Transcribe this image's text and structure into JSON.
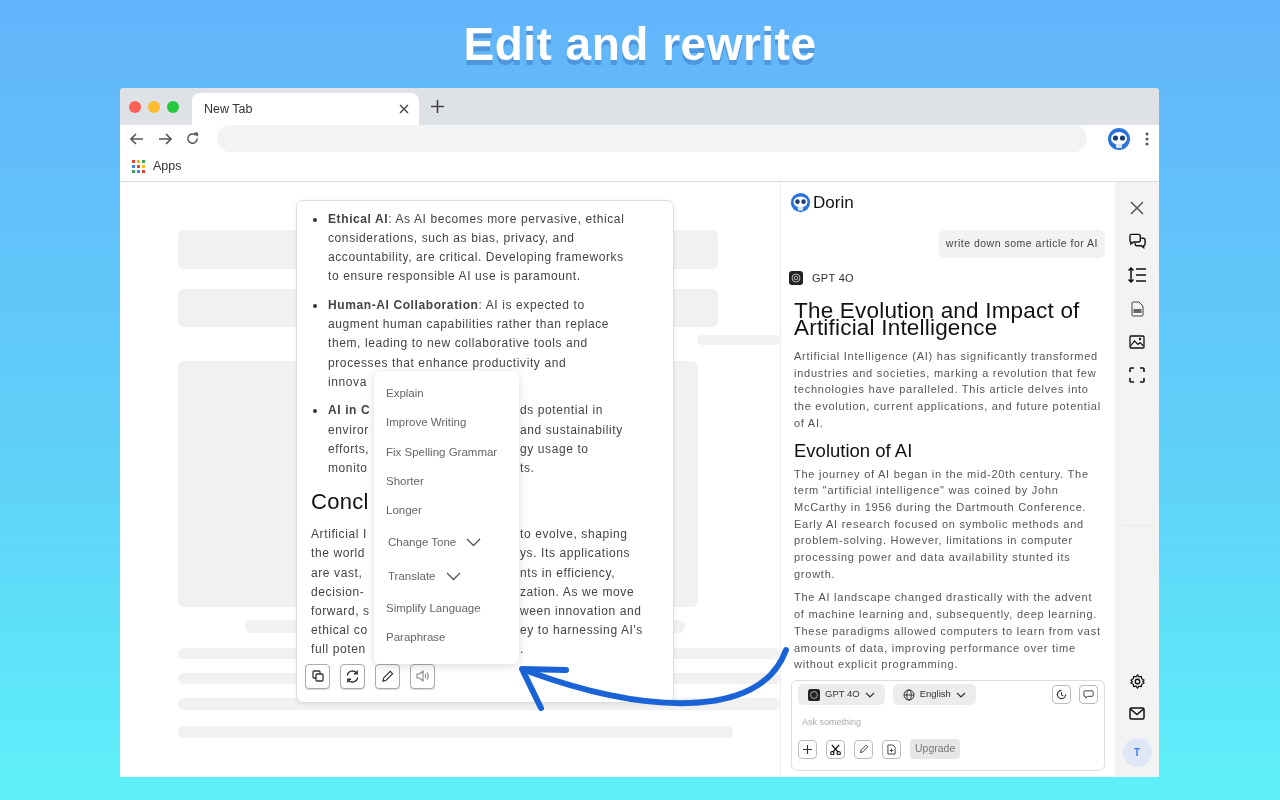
{
  "title": "Edit and rewrite",
  "browser": {
    "tab": {
      "label": "New Tab"
    },
    "bookmarks": [
      {
        "label": "Apps"
      }
    ]
  },
  "answer_card": {
    "blocks": [
      {
        "kind": "bullet",
        "lines": [
          {
            "text": "**Ethical AI**: As AI becomes more pervasive, ethical"
          },
          {
            "text": "considerations, such as bias, privacy, and"
          },
          {
            "text": "accountability, are critical. Developing frameworks"
          },
          {
            "text": "to ensure responsible AI use is paramount."
          }
        ]
      },
      {
        "kind": "bullet",
        "lines": [
          {
            "text": "**Human-AI Collaboration**: AI is expected to"
          },
          {
            "text": "augment human capabilities rather than replace"
          },
          {
            "text": "them, leading to new collaborative tools and"
          },
          {
            "text": "processes that enhance productivity and"
          },
          {
            "text": "innova"
          }
        ]
      },
      {
        "kind": "bullet",
        "lines": [
          {
            "left": "**AI in C**",
            "right": "ds potential in"
          },
          {
            "left": "enviror",
            "right": "and sustainability"
          },
          {
            "left": "efforts,",
            "right": "gy usage to"
          },
          {
            "left": "monito",
            "right": "ts."
          }
        ]
      },
      {
        "kind": "heading",
        "lines": [
          {
            "text": "Concl"
          }
        ]
      },
      {
        "kind": "paragraph",
        "lines": [
          {
            "left": "Artificial I",
            "right": "to evolve, shaping"
          },
          {
            "left": "the world",
            "right": "ys. Its applications"
          },
          {
            "left": "are vast,",
            "right": "nts in efficiency,"
          },
          {
            "left": "decision-",
            "right": "zation. As we move"
          },
          {
            "left": "forward, s",
            "right": "ween innovation and"
          },
          {
            "left": "ethical co",
            "right": "ey to harnessing AI's"
          },
          {
            "left": "full poten",
            "right": "."
          }
        ]
      }
    ],
    "menu": [
      {
        "label": "Explain",
        "kind": "item"
      },
      {
        "label": "Improve Writing",
        "kind": "item"
      },
      {
        "label": "Fix Spelling Grammar",
        "kind": "item"
      },
      {
        "label": "Shorter",
        "kind": "item"
      },
      {
        "label": "Longer",
        "kind": "item"
      },
      {
        "label": "Change Tone",
        "kind": "submenu"
      },
      {
        "label": "Translate",
        "kind": "submenu"
      },
      {
        "label": "Simplify Language",
        "kind": "item"
      },
      {
        "label": "Paraphrase",
        "kind": "item"
      }
    ]
  },
  "chat": {
    "brand": "Dorin",
    "user_message": "write down some article for AI",
    "model": "GPT 4O",
    "answer": [
      {
        "kind": "heading",
        "text": "The Evolution and Impact of Artificial Intelligence"
      },
      {
        "kind": "paragraph",
        "text": "Artificial Intelligence (AI) has significantly transformed industries and societies, marking a revolution that few technologies have paralleled. This article delves into the evolution, current applications, and future potential of AI."
      },
      {
        "kind": "subheading",
        "text": "Evolution of AI"
      },
      {
        "kind": "paragraph",
        "text": "The journey of AI began in the mid-20th century. The term \"artificial intelligence\" was coined by John McCarthy in 1956 during the Dartmouth Conference. Early AI research focused on symbolic methods and problem-solving. However, limitations in computer processing power and data availability stunted its growth."
      },
      {
        "kind": "paragraph",
        "text": "The AI landscape changed drastically with the advent of machine learning and, subsequently, deep learning. These paradigms allowed computers to learn from vast amounts of data, improving performance over time without explicit programming."
      }
    ],
    "composer": {
      "model": "GPT 4O",
      "language": "English",
      "placeholder": "Ask something",
      "upgrade": "Upgrade"
    }
  },
  "avatar": "T"
}
